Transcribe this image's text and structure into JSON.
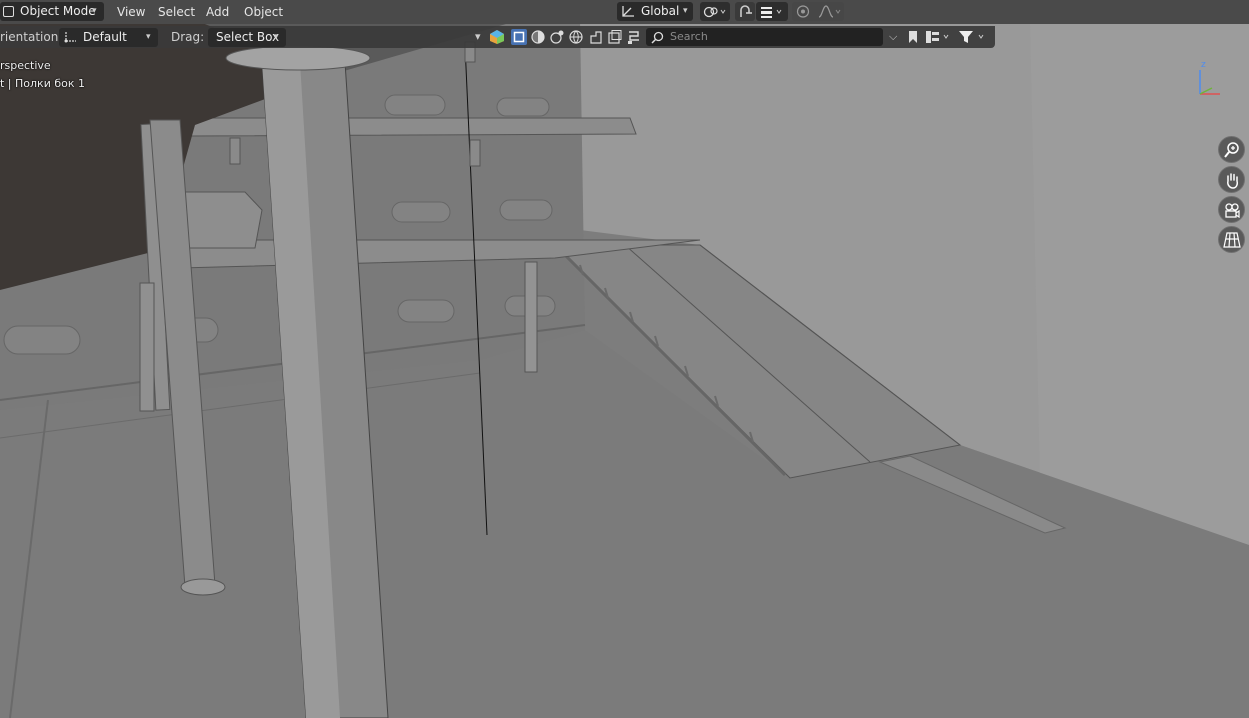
{
  "header": {
    "mode": "Object Mode",
    "menus": [
      "View",
      "Select",
      "Add",
      "Object"
    ],
    "transform_orientation": "Global"
  },
  "tool_settings": {
    "orientation_label": "rientation:",
    "orientation_value": "Default",
    "drag_label": "Drag:",
    "drag_value": "Select Box"
  },
  "outliner_filter": {
    "search_placeholder": "Search"
  },
  "viewport_overlay": {
    "view_name": "rspective",
    "object_info": "t | Полки бок 1"
  },
  "gizmo": {
    "axis_z": "z"
  },
  "colors": {
    "header_bg": "#4a4a4a",
    "toolrow_bg": "#3a3a3a",
    "dark_field": "#2a2a2a",
    "viewport_wall": "#9a9a9a",
    "viewport_floor": "#7c7c7c",
    "active_blue": "#4772b3"
  },
  "icons": [
    "object-mode-icon",
    "transform-orientation-icon",
    "snap-icon",
    "proportional-edit-icon",
    "view-zoom-icon",
    "view-pan-icon",
    "camera-view-icon",
    "ortho-grid-icon",
    "search-icon",
    "filter-icon"
  ]
}
